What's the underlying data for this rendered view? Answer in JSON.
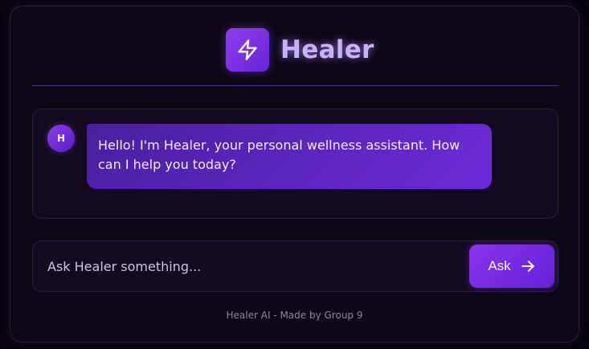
{
  "header": {
    "app_name": "Healer",
    "logo_icon": "lightning-bolt-icon"
  },
  "chat": {
    "messages": [
      {
        "sender_initial": "H",
        "text": "Hello! I'm Healer, your personal wellness assistant. How can I help you today?"
      }
    ]
  },
  "composer": {
    "placeholder": "Ask Healer something...",
    "value": "",
    "send_label": "Ask",
    "send_icon": "arrow-right-icon"
  },
  "footer": {
    "text": "Healer AI - Made by Group 9"
  },
  "colors": {
    "accent": "#7a2fe6",
    "accent_light": "#c7b2f5",
    "background": "#0d0716"
  }
}
